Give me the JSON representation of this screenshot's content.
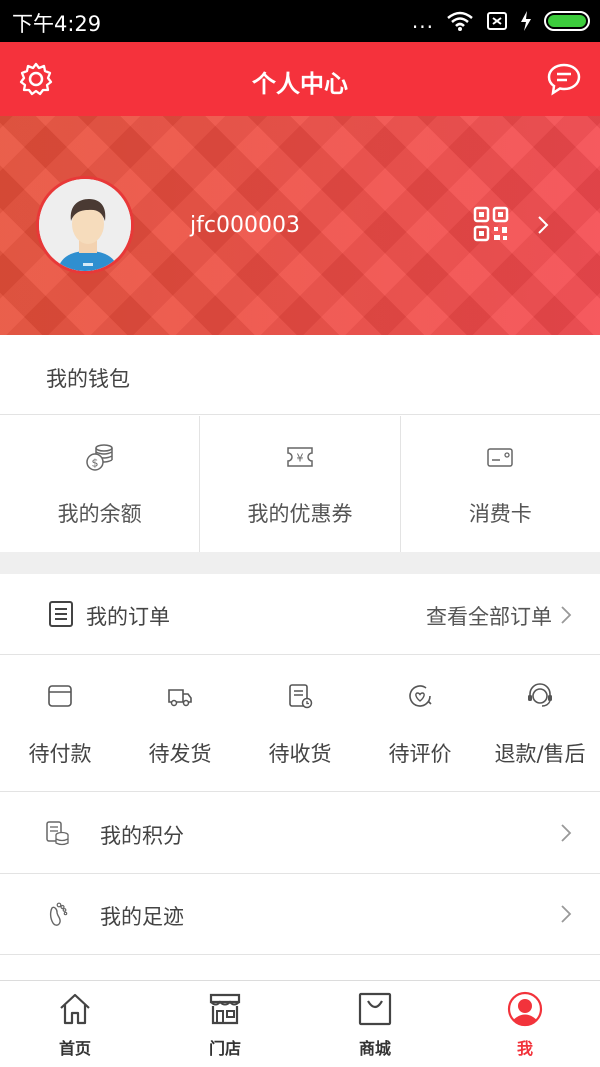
{
  "status_bar": {
    "time": "下午4:29",
    "dots": "...",
    "icons": [
      "wifi-icon",
      "sim-icon",
      "charging-icon",
      "battery-icon"
    ]
  },
  "header": {
    "title": "个人中心",
    "left_icon": "gear-icon",
    "right_icon": "message-icon"
  },
  "profile": {
    "username": "jfc000003",
    "qr_icon": "qr-code-icon"
  },
  "wallet": {
    "title": "我的钱包",
    "items": [
      {
        "label": "我的余额",
        "icon": "coins-icon"
      },
      {
        "label": "我的优惠券",
        "icon": "coupon-icon"
      },
      {
        "label": "消费卡",
        "icon": "card-icon"
      }
    ]
  },
  "orders": {
    "title": "我的订单",
    "view_all": "查看全部订单",
    "items": [
      {
        "label": "待付款",
        "icon": "wallet-icon"
      },
      {
        "label": "待发货",
        "icon": "truck-icon"
      },
      {
        "label": "待收货",
        "icon": "receipt-icon"
      },
      {
        "label": "待评价",
        "icon": "review-icon"
      },
      {
        "label": "退款/售后",
        "icon": "headset-icon"
      }
    ]
  },
  "menu": [
    {
      "label": "我的积分",
      "icon": "points-icon"
    },
    {
      "label": "我的足迹",
      "icon": "footprint-icon"
    }
  ],
  "tabbar": {
    "items": [
      {
        "label": "首页",
        "icon": "home-icon"
      },
      {
        "label": "门店",
        "icon": "store-icon"
      },
      {
        "label": "商城",
        "icon": "shopping-bag-icon"
      },
      {
        "label": "我",
        "icon": "user-icon",
        "active": true
      }
    ],
    "active_color": "#f2333b"
  },
  "colors": {
    "brand": "#f5323c",
    "background_gap": "#efefef"
  }
}
